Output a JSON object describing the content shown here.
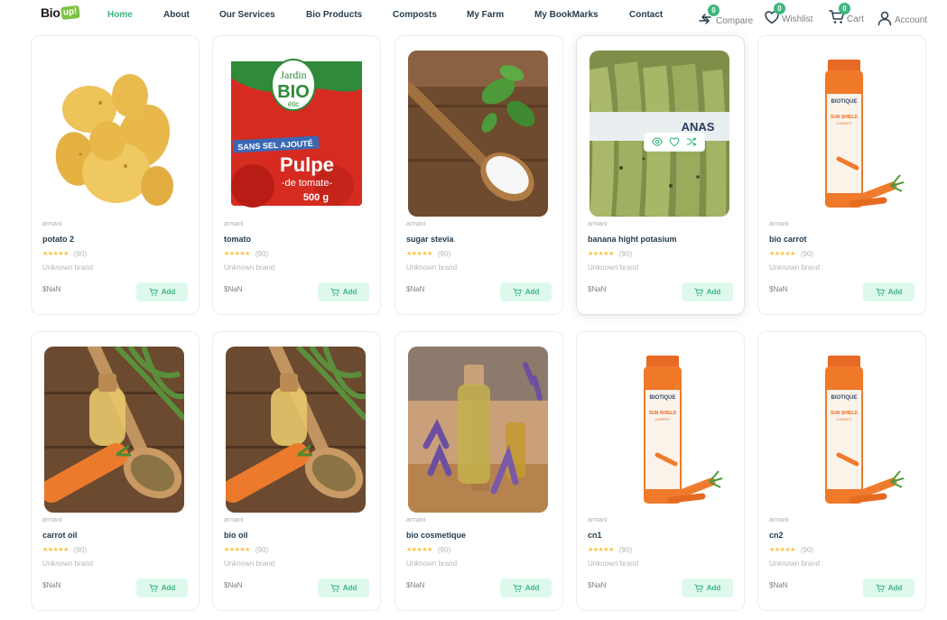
{
  "brand": {
    "logo_text": "Bio",
    "logo_badge": "up!"
  },
  "nav": [
    {
      "label": "Home",
      "active": true
    },
    {
      "label": "About"
    },
    {
      "label": "Our Services"
    },
    {
      "label": "Bio Products"
    },
    {
      "label": "Composts"
    },
    {
      "label": "My Farm"
    },
    {
      "label": "My BookMarks"
    },
    {
      "label": "Contact"
    }
  ],
  "header_actions": {
    "compare": {
      "label": "Compare",
      "count": "0",
      "icon": "compare-icon"
    },
    "wishlist": {
      "label": "Wishlist",
      "count": "0",
      "icon": "heart-icon"
    },
    "cart": {
      "label": "Cart",
      "count": "0",
      "icon": "cart-icon"
    },
    "account": {
      "label": "Account",
      "icon": "user-icon"
    }
  },
  "colors": {
    "accent": "#3bb77e",
    "add_button_bg": "#def9ec",
    "star": "#fdc040",
    "heading": "#253d4e"
  },
  "add_label": "Add",
  "products": [
    {
      "category": "armani",
      "name": "potato 2",
      "stars": "★★★★★",
      "rating_count": "(90)",
      "brand": "Unknown brand",
      "price": "$NaN",
      "image": "potatoes"
    },
    {
      "category": "armani",
      "name": "tomato",
      "stars": "★★★★★",
      "rating_count": "(90)",
      "brand": "Unknown brand",
      "price": "$NaN",
      "image": "tomato-pulp-box"
    },
    {
      "category": "armani",
      "name": "sugar stevia",
      "stars": "★★★★★",
      "rating_count": "(90)",
      "brand": "Unknown brand",
      "price": "$NaN",
      "image": "stevia-spoon"
    },
    {
      "category": "armani",
      "name": "banana hight potasium",
      "stars": "★★★★★",
      "rating_count": "(90)",
      "brand": "Unknown brand",
      "price": "$NaN",
      "image": "green-bananas",
      "hovered": true
    },
    {
      "category": "armani",
      "name": "bio carrot",
      "stars": "★★★★★",
      "rating_count": "(90)",
      "brand": "Unknown brand",
      "price": "$NaN",
      "image": "sunscreen-bottle"
    },
    {
      "category": "armani",
      "name": "carrot oil",
      "stars": "★★★★★",
      "rating_count": "(90)",
      "brand": "Unknown brand",
      "price": "$NaN",
      "image": "carrot-oil"
    },
    {
      "category": "armani",
      "name": "bio oil",
      "stars": "★★★★★",
      "rating_count": "(90)",
      "brand": "Unknown brand",
      "price": "$NaN",
      "image": "carrot-oil"
    },
    {
      "category": "armani",
      "name": "bio cosmetique",
      "stars": "★★★★★",
      "rating_count": "(90)",
      "brand": "Unknown brand",
      "price": "$NaN",
      "image": "lavender-oil"
    },
    {
      "category": "armani",
      "name": "cn1",
      "stars": "★★★★★",
      "rating_count": "(90)",
      "brand": "Unknown brand",
      "price": "$NaN",
      "image": "sunscreen-bottle"
    },
    {
      "category": "armani",
      "name": "cn2",
      "stars": "★★★★★",
      "rating_count": "(90)",
      "brand": "Unknown brand",
      "price": "$NaN",
      "image": "sunscreen-bottle"
    }
  ],
  "image_text": {
    "tomato_box": {
      "brand_top": "Jardin",
      "brand_main": "BIO",
      "brand_sub": "étic",
      "ribbon": "SANS SEL AJOUTÉ",
      "product": "Pulpe",
      "product_sub": "-de tomate-",
      "weight": "500 g"
    },
    "banana_label": "ANAS",
    "sunscreen": {
      "brand": "BIOTIQUE",
      "line": "SUN SHIELD",
      "variant": "CARROT"
    }
  },
  "hovered_quick_actions": [
    {
      "icon": "eye-icon"
    },
    {
      "icon": "heart-icon"
    },
    {
      "icon": "shuffle-icon"
    }
  ]
}
